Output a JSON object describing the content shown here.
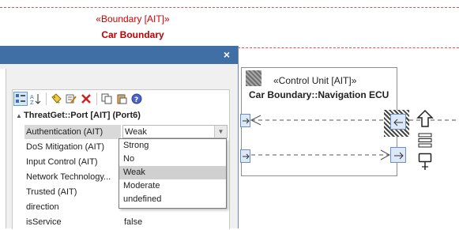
{
  "diagram": {
    "boundary": {
      "stereotype": "«Boundary [AIT]»",
      "name": "Car Boundary"
    },
    "node": {
      "stereotype": "«Control Unit [AIT]»",
      "name": "Car Boundary::Navigation ECU"
    },
    "colors": {
      "boundary": "#d00000",
      "port_fill": "#dde9f8",
      "port_border": "#6d8fbf"
    }
  },
  "dialog": {
    "close_label": "×",
    "toolbar": [
      "categorized-icon",
      "sort-az-icon",
      "new-tag-icon",
      "edit-tag-icon",
      "delete-icon",
      "copy-icon",
      "paste-icon",
      "help-icon"
    ],
    "group_title": "ThreatGet::Port [AIT] (Port6)",
    "properties": [
      {
        "name": "Authentication (AIT)",
        "value": "Weak"
      },
      {
        "name": "DoS Mitigation (AIT)",
        "value": ""
      },
      {
        "name": "Input Control (AIT)",
        "value": ""
      },
      {
        "name": "Network Technology...",
        "value": ""
      },
      {
        "name": "Trusted (AIT)",
        "value": ""
      },
      {
        "name": "direction",
        "value": ""
      },
      {
        "name": "isService",
        "value": "false"
      }
    ],
    "dropdown": {
      "options": [
        "Strong",
        "No",
        "Weak",
        "Moderate",
        "undefined"
      ],
      "highlighted": "Weak"
    }
  }
}
